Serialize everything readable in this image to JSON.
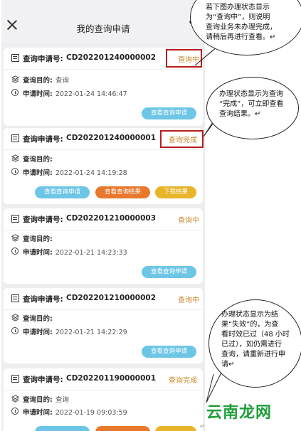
{
  "header": {
    "title": "我的查询申请"
  },
  "cards": [
    {
      "label": "查询申请号:",
      "number": "CD202201240000002",
      "status": "查询中",
      "purpose_label": "查询目的:",
      "purpose": "查询",
      "time_label": "申请时间:",
      "time": "2022-01-24 14:46:47",
      "buttons": [
        "查看查询申请"
      ]
    },
    {
      "label": "查询申请号:",
      "number": "CD202201240000001",
      "status": "查询完成",
      "purpose_label": "查询目的:",
      "purpose": "",
      "time_label": "申请时间:",
      "time": "2022-01-24 14:19:28",
      "buttons": [
        "查看查询申请",
        "查看查询结果",
        "下载结果"
      ]
    },
    {
      "label": "查询申请号:",
      "number": "CD202201210000003",
      "status": "查询中",
      "purpose_label": "查询目的:",
      "purpose": "",
      "time_label": "申请时间:",
      "time": "2022-01-21 14:23:33",
      "buttons": [
        "查看查询申请"
      ]
    },
    {
      "label": "查询申请号:",
      "number": "CD202201210000002",
      "status": "查询中",
      "purpose_label": "查询目的:",
      "purpose": "",
      "time_label": "申请时间:",
      "time": "2022-01-21 14:22:29",
      "buttons": [
        "查看查询申请"
      ]
    },
    {
      "label": "查询申请号:",
      "number": "CD202201190000001",
      "status": "查询完成",
      "purpose_label": "查询目的:",
      "purpose": "查询",
      "time_label": "申请时间:",
      "time": "2022-01-19 09:03:59",
      "buttons": []
    }
  ],
  "callouts": {
    "c1": [
      "若下图办理状态显示",
      "为“查询中”，则说明",
      "查询业务未办理完成，",
      "请稍后再进行查看。↵"
    ],
    "c2": [
      "办理状态显示为查询",
      "“完成”，可立即查看",
      "查询结果。↵"
    ],
    "c3": [
      "办理状态显示为结",
      "果“失效”的，为查",
      "看时效已过（48 小时",
      "已过），如仍需进行",
      "查询，请重新进行申",
      "请↵"
    ]
  },
  "watermark": "云南龙网",
  "paragraph_mark": "↵",
  "colors": {
    "status": "#c8892a",
    "highlight_box": "#b41e1e",
    "btn_blue": "#6ec6e6",
    "btn_orange": "#e8792c",
    "btn_yellow": "#e8b52a",
    "watermark": "#1e9e3a"
  }
}
